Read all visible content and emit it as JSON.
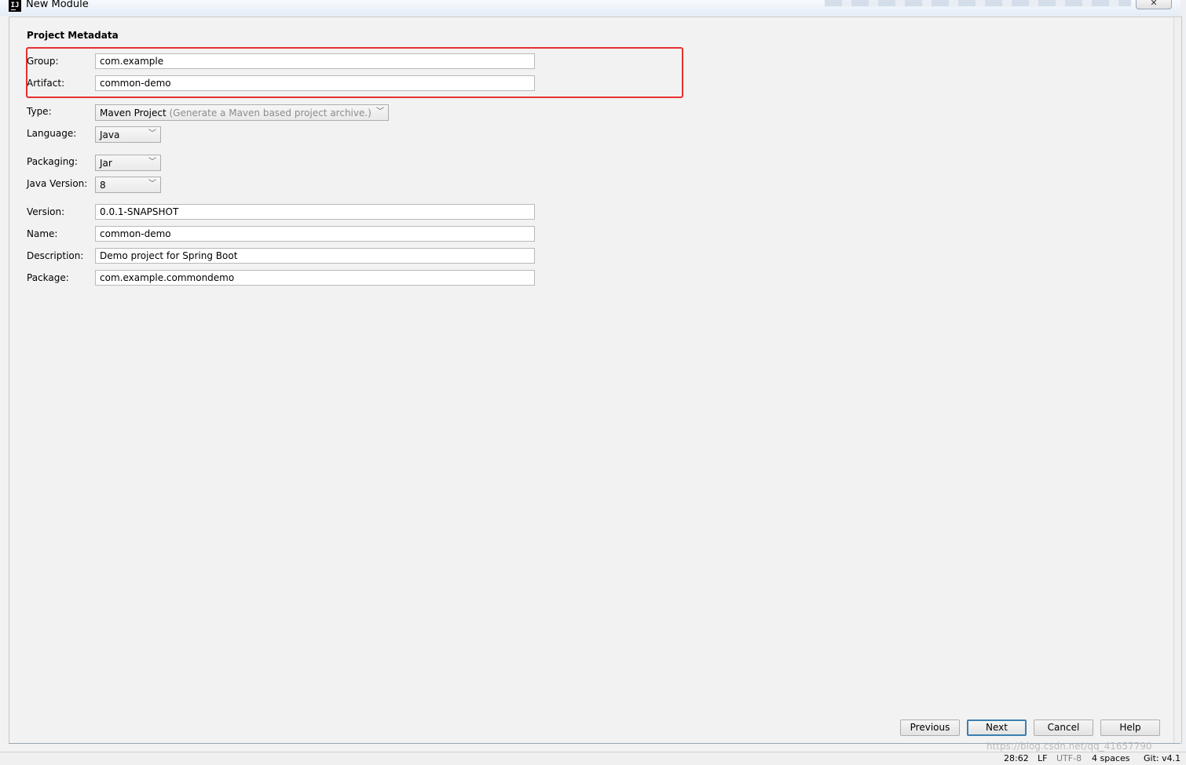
{
  "window": {
    "title": "New Module",
    "app_icon_text": "IJ",
    "close_icon": "close-icon",
    "close_glyph": "✕"
  },
  "form": {
    "section_title": "Project Metadata",
    "group": {
      "label": "Group:",
      "value": "com.example"
    },
    "artifact": {
      "label": "Artifact:",
      "value": "common-demo"
    },
    "type": {
      "label": "Type:",
      "value": "Maven Project",
      "hint": "(Generate a Maven based project archive.)"
    },
    "language": {
      "label": "Language:",
      "value": "Java"
    },
    "packaging": {
      "label": "Packaging:",
      "value": "Jar"
    },
    "java_version": {
      "label": "Java Version:",
      "value": "8"
    },
    "version": {
      "label": "Version:",
      "value": "0.0.1-SNAPSHOT"
    },
    "name": {
      "label": "Name:",
      "value": "common-demo"
    },
    "description": {
      "label": "Description:",
      "value": "Demo project for Spring Boot"
    },
    "package": {
      "label": "Package:",
      "value": "com.example.commondemo"
    }
  },
  "buttons": {
    "previous": "Previous",
    "next": "Next",
    "cancel": "Cancel",
    "help": "Help"
  },
  "status_bar": {
    "position": "28:62",
    "line_sep": "LF",
    "encoding": "UTF-8",
    "indent": "4 spaces",
    "git": "Git: v4.1"
  },
  "watermark": "https://blog.csdn.net/qq_41657790",
  "colors": {
    "highlight": "#e83030",
    "primary_button_border": "#3c7fb1",
    "dialog_bg": "#f2f2f2"
  }
}
